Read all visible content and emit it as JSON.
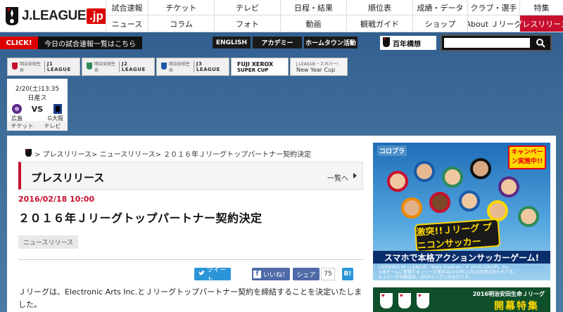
{
  "header": {
    "logo_text": "J.LEAGUE",
    "logo_suffix": ".jp",
    "nav_row1": [
      "試合速報",
      "チケット",
      "テレビ",
      "日程・結果",
      "順位表",
      "成績・データ",
      "クラブ・選手",
      "特集"
    ],
    "nav_row2": [
      "ニュース",
      "コラム",
      "フォト",
      "動画",
      "観戦ガイド",
      "ショップ",
      "About Ｊリーグ",
      "プレスリリース"
    ],
    "active_index": 7
  },
  "subbar": {
    "click_label": "CLICK!",
    "click_info": "今日の試合速報一覧はこちら",
    "lang_buttons": [
      "ENGLISH",
      "アカデミー",
      "ホームタウン活動"
    ],
    "hyakunen_label": "百年構想",
    "search_placeholder": ""
  },
  "league_tabs": {
    "j1_small": "明治安田生命",
    "j1_big": "J1 LEAGUE",
    "j2_small": "明治安田生命",
    "j2_big": "J2 LEAGUE",
    "j3_small": "明治安田生命",
    "j3_big": "J3 LEAGUE",
    "xerox_a": "FUJI XEROX",
    "xerox_b": "SUPER CUP",
    "nyc_a": "J.LEAGUE・スカパー!",
    "nyc_b": "New Year Cup"
  },
  "match": {
    "datetime": "2/20(土)13:35",
    "venue": "日産ス",
    "vs": "VS",
    "home": "広島",
    "away": "G大阪",
    "link_ticket": "チケット",
    "link_tv": "テレビ"
  },
  "content": {
    "breadcrumb": "> プレスリリース> ニュースリリース> ２０１６年Ｊリーグトップパートナー契約決定",
    "section_title": "プレスリリース",
    "more_label": "一覧へ",
    "date": "2016/02/18 10:00",
    "headline": "２０１６年Ｊリーグトップパートナー契約決定",
    "tag": "ニュースリリース",
    "share": {
      "tweet": "ツイート",
      "like": "いいね！",
      "share": "シェア",
      "count": "75",
      "hatena": "B!"
    },
    "body": "Ｊリーグは、Electronic Arts Inc.とＪリーグトップパートナー契約を締結することを決定いたしました。"
  },
  "ad": {
    "brand": "コロプラ",
    "campaign": "キャンペーン実施中!!",
    "logo": "激突!!Ｊリーグ プニコンサッカー",
    "slogan": "スマホで本格アクションサッカーゲーム!",
    "license1": "LICENSED BY J.LEAGUE／Stats Stadium／© 2016 COLOPL, Inc.",
    "license2": "※本ゲームに登場するＪリーグ選手は2015年11月20日時点のものです。",
    "license3": "※Ｊリーグの表記は、2015シーズンのものです。",
    "ad2_small": "2016明治安田生命Ｊリーグ",
    "ad2_big": "開幕特集"
  },
  "colors": {
    "accent_red": "#c8102e",
    "twitter_blue": "#2b95d8",
    "facebook_blue": "#4e6aa8"
  }
}
